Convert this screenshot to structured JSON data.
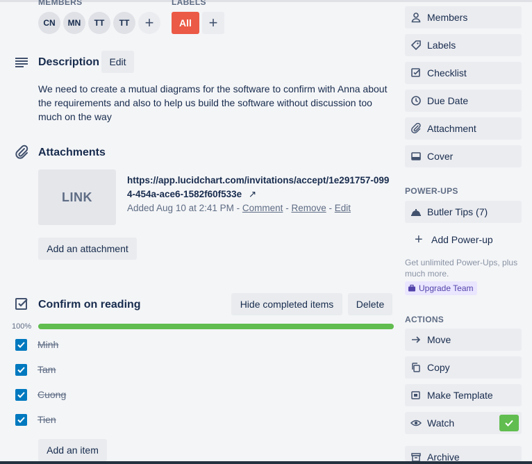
{
  "members": {
    "heading": "MEMBERS",
    "avatars": [
      "CN",
      "MN",
      "TT",
      "TT"
    ],
    "add_icon": "plus-icon"
  },
  "labels": {
    "heading": "LABELS",
    "chip": "All",
    "chip_color": "#eb5a46"
  },
  "description": {
    "title": "Description",
    "edit_label": "Edit",
    "text": "We need to create a mutual diagrams for the software to confirm with Anna about the requirements and also to help us build the software without discussion too much on the way"
  },
  "attachments": {
    "title": "Attachments",
    "thumb_label": "LINK",
    "url": "https://app.lucidchart.com/invitations/accept/1e291757-0994-454a-ace6-1582f60f533e",
    "open_icon": "↗",
    "added": "Added Aug 10 at 2:41 PM",
    "sep": "-",
    "comment": "Comment",
    "remove": "Remove",
    "edit": "Edit",
    "add_label": "Add an attachment"
  },
  "checklist": {
    "title": "Confirm on reading",
    "hide_label": "Hide completed items",
    "delete_label": "Delete",
    "percent_label": "100%",
    "progress": 1.0,
    "items": [
      "Minh",
      "Tam",
      "Cuong",
      "Tien"
    ],
    "add_item_label": "Add an item"
  },
  "sidebar": {
    "add_to_card": [
      "Members",
      "Labels",
      "Checklist",
      "Due Date",
      "Attachment",
      "Cover"
    ],
    "powerups_heading": "POWER-UPS",
    "butler": "Butler Tips (7)",
    "add_powerup": "Add Power-up",
    "note": "Get unlimited Power-Ups, plus much more.",
    "upgrade": "Upgrade Team",
    "actions_heading": "ACTIONS",
    "actions": [
      "Move",
      "Copy",
      "Make Template",
      "Watch",
      "Archive"
    ]
  },
  "colors": {
    "accent": "#0079bf",
    "progress": "#61bd4f",
    "watch_on": "#61bd4f"
  }
}
